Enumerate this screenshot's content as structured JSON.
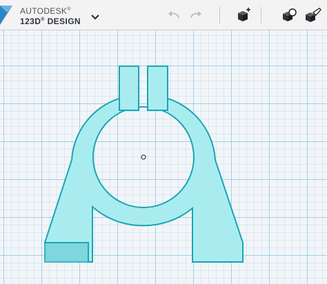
{
  "app": {
    "brand_line1": "AUTODESK",
    "brand_line1_mark": "®",
    "brand_line2": "123D",
    "brand_line2_mark": "®",
    "brand_line2_rest": " DESIGN"
  },
  "toolbar": {
    "icons": [
      "chevron-down-icon",
      "undo-icon",
      "redo-icon",
      "add-primitive-icon",
      "material-icon",
      "inspect-icon"
    ]
  },
  "colors": {
    "part_fill": "#a9ecef",
    "part_edge": "#1aa5b4",
    "part_side": "#6fd0d8",
    "grid_line": "#74bce4",
    "logo_accent": "#2d84c6"
  }
}
